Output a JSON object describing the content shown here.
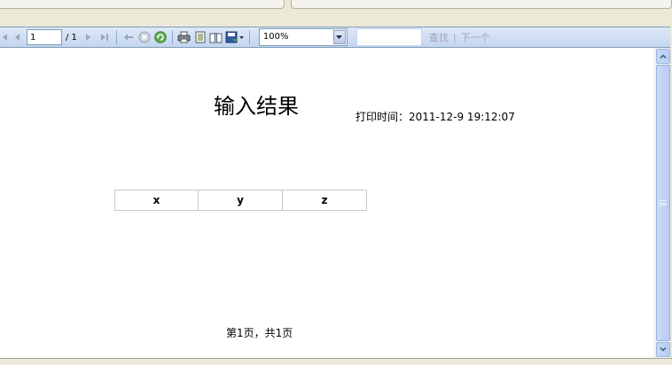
{
  "toolbar": {
    "page_value": "1",
    "page_total": "/ 1",
    "zoom_value": "100%",
    "search_value": "",
    "find_label": "查找",
    "find_separator": "|",
    "next_label": "下一个"
  },
  "report": {
    "title": "输入结果",
    "print_time_label": "打印时间：",
    "print_time_value": "2011-12-9 19:12:07",
    "columns": [
      "x",
      "y",
      "z"
    ],
    "footer": "第1页，共1页"
  },
  "colors": {
    "toolbar_top": "#dfe9f7",
    "toolbar_bottom": "#c3d5ef",
    "scrollbar_accent": "#b7cdf5",
    "disabled_text": "#9aa6b8"
  }
}
